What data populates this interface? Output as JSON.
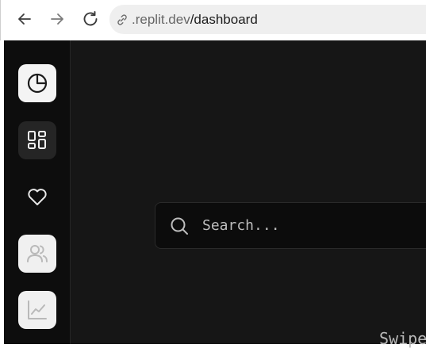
{
  "browser": {
    "url_host": ".replit.dev",
    "url_path": "/dashboard",
    "back_icon": "arrow-left-icon",
    "forward_icon": "arrow-right-icon",
    "reload_icon": "reload-icon",
    "site_icon": "link-icon"
  },
  "sidebar": {
    "items": [
      {
        "name": "sidebar-item-overview",
        "icon": "pie-chart-icon",
        "state": "active"
      },
      {
        "name": "sidebar-item-dashboard",
        "icon": "grid-icon",
        "state": "hover"
      },
      {
        "name": "sidebar-item-favorites",
        "icon": "heart-icon",
        "state": "default"
      },
      {
        "name": "sidebar-item-users",
        "icon": "users-icon",
        "state": "faded"
      },
      {
        "name": "sidebar-item-analytics",
        "icon": "line-chart-icon",
        "state": "faded"
      }
    ]
  },
  "search": {
    "placeholder": "Search..."
  },
  "hint": {
    "text": "Swipe"
  },
  "colors": {
    "app_bg": "#161616",
    "sidebar_bg": "#0d0d0d",
    "search_bg": "#0c0c0c"
  }
}
